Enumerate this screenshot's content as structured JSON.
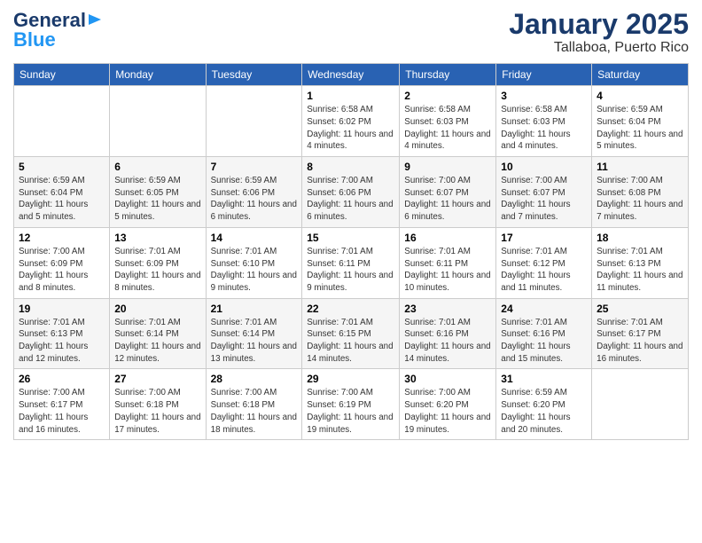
{
  "header": {
    "logo_general": "General",
    "logo_blue": "Blue",
    "month_title": "January 2025",
    "location": "Tallaboa, Puerto Rico"
  },
  "days_of_week": [
    "Sunday",
    "Monday",
    "Tuesday",
    "Wednesday",
    "Thursday",
    "Friday",
    "Saturday"
  ],
  "weeks": [
    [
      {
        "day": "",
        "info": ""
      },
      {
        "day": "",
        "info": ""
      },
      {
        "day": "",
        "info": ""
      },
      {
        "day": "1",
        "info": "Sunrise: 6:58 AM\nSunset: 6:02 PM\nDaylight: 11 hours and 4 minutes."
      },
      {
        "day": "2",
        "info": "Sunrise: 6:58 AM\nSunset: 6:03 PM\nDaylight: 11 hours and 4 minutes."
      },
      {
        "day": "3",
        "info": "Sunrise: 6:58 AM\nSunset: 6:03 PM\nDaylight: 11 hours and 4 minutes."
      },
      {
        "day": "4",
        "info": "Sunrise: 6:59 AM\nSunset: 6:04 PM\nDaylight: 11 hours and 5 minutes."
      }
    ],
    [
      {
        "day": "5",
        "info": "Sunrise: 6:59 AM\nSunset: 6:04 PM\nDaylight: 11 hours and 5 minutes."
      },
      {
        "day": "6",
        "info": "Sunrise: 6:59 AM\nSunset: 6:05 PM\nDaylight: 11 hours and 5 minutes."
      },
      {
        "day": "7",
        "info": "Sunrise: 6:59 AM\nSunset: 6:06 PM\nDaylight: 11 hours and 6 minutes."
      },
      {
        "day": "8",
        "info": "Sunrise: 7:00 AM\nSunset: 6:06 PM\nDaylight: 11 hours and 6 minutes."
      },
      {
        "day": "9",
        "info": "Sunrise: 7:00 AM\nSunset: 6:07 PM\nDaylight: 11 hours and 6 minutes."
      },
      {
        "day": "10",
        "info": "Sunrise: 7:00 AM\nSunset: 6:07 PM\nDaylight: 11 hours and 7 minutes."
      },
      {
        "day": "11",
        "info": "Sunrise: 7:00 AM\nSunset: 6:08 PM\nDaylight: 11 hours and 7 minutes."
      }
    ],
    [
      {
        "day": "12",
        "info": "Sunrise: 7:00 AM\nSunset: 6:09 PM\nDaylight: 11 hours and 8 minutes."
      },
      {
        "day": "13",
        "info": "Sunrise: 7:01 AM\nSunset: 6:09 PM\nDaylight: 11 hours and 8 minutes."
      },
      {
        "day": "14",
        "info": "Sunrise: 7:01 AM\nSunset: 6:10 PM\nDaylight: 11 hours and 9 minutes."
      },
      {
        "day": "15",
        "info": "Sunrise: 7:01 AM\nSunset: 6:11 PM\nDaylight: 11 hours and 9 minutes."
      },
      {
        "day": "16",
        "info": "Sunrise: 7:01 AM\nSunset: 6:11 PM\nDaylight: 11 hours and 10 minutes."
      },
      {
        "day": "17",
        "info": "Sunrise: 7:01 AM\nSunset: 6:12 PM\nDaylight: 11 hours and 11 minutes."
      },
      {
        "day": "18",
        "info": "Sunrise: 7:01 AM\nSunset: 6:13 PM\nDaylight: 11 hours and 11 minutes."
      }
    ],
    [
      {
        "day": "19",
        "info": "Sunrise: 7:01 AM\nSunset: 6:13 PM\nDaylight: 11 hours and 12 minutes."
      },
      {
        "day": "20",
        "info": "Sunrise: 7:01 AM\nSunset: 6:14 PM\nDaylight: 11 hours and 12 minutes."
      },
      {
        "day": "21",
        "info": "Sunrise: 7:01 AM\nSunset: 6:14 PM\nDaylight: 11 hours and 13 minutes."
      },
      {
        "day": "22",
        "info": "Sunrise: 7:01 AM\nSunset: 6:15 PM\nDaylight: 11 hours and 14 minutes."
      },
      {
        "day": "23",
        "info": "Sunrise: 7:01 AM\nSunset: 6:16 PM\nDaylight: 11 hours and 14 minutes."
      },
      {
        "day": "24",
        "info": "Sunrise: 7:01 AM\nSunset: 6:16 PM\nDaylight: 11 hours and 15 minutes."
      },
      {
        "day": "25",
        "info": "Sunrise: 7:01 AM\nSunset: 6:17 PM\nDaylight: 11 hours and 16 minutes."
      }
    ],
    [
      {
        "day": "26",
        "info": "Sunrise: 7:00 AM\nSunset: 6:17 PM\nDaylight: 11 hours and 16 minutes."
      },
      {
        "day": "27",
        "info": "Sunrise: 7:00 AM\nSunset: 6:18 PM\nDaylight: 11 hours and 17 minutes."
      },
      {
        "day": "28",
        "info": "Sunrise: 7:00 AM\nSunset: 6:18 PM\nDaylight: 11 hours and 18 minutes."
      },
      {
        "day": "29",
        "info": "Sunrise: 7:00 AM\nSunset: 6:19 PM\nDaylight: 11 hours and 19 minutes."
      },
      {
        "day": "30",
        "info": "Sunrise: 7:00 AM\nSunset: 6:20 PM\nDaylight: 11 hours and 19 minutes."
      },
      {
        "day": "31",
        "info": "Sunrise: 6:59 AM\nSunset: 6:20 PM\nDaylight: 11 hours and 20 minutes."
      },
      {
        "day": "",
        "info": ""
      }
    ]
  ]
}
